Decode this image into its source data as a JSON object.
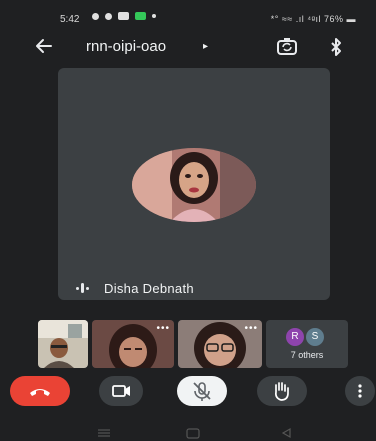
{
  "status_bar": {
    "time": "5:42",
    "right": "*° ≈≈ .ıl ⁴ᵍıl 76% ▬"
  },
  "header": {
    "meeting_code": "rnn-oipi-oao",
    "caret": "▸"
  },
  "main_speaker": {
    "name": "Disha Debnath"
  },
  "others": {
    "avatars": [
      "R",
      "S"
    ],
    "label": "7 others"
  },
  "thumb_menu": "•••",
  "colors": {
    "end_call": "#ea4335",
    "tile_bg": "#3c4043",
    "avatar_r": "#8e44ad",
    "avatar_s": "#5f7d8e"
  }
}
